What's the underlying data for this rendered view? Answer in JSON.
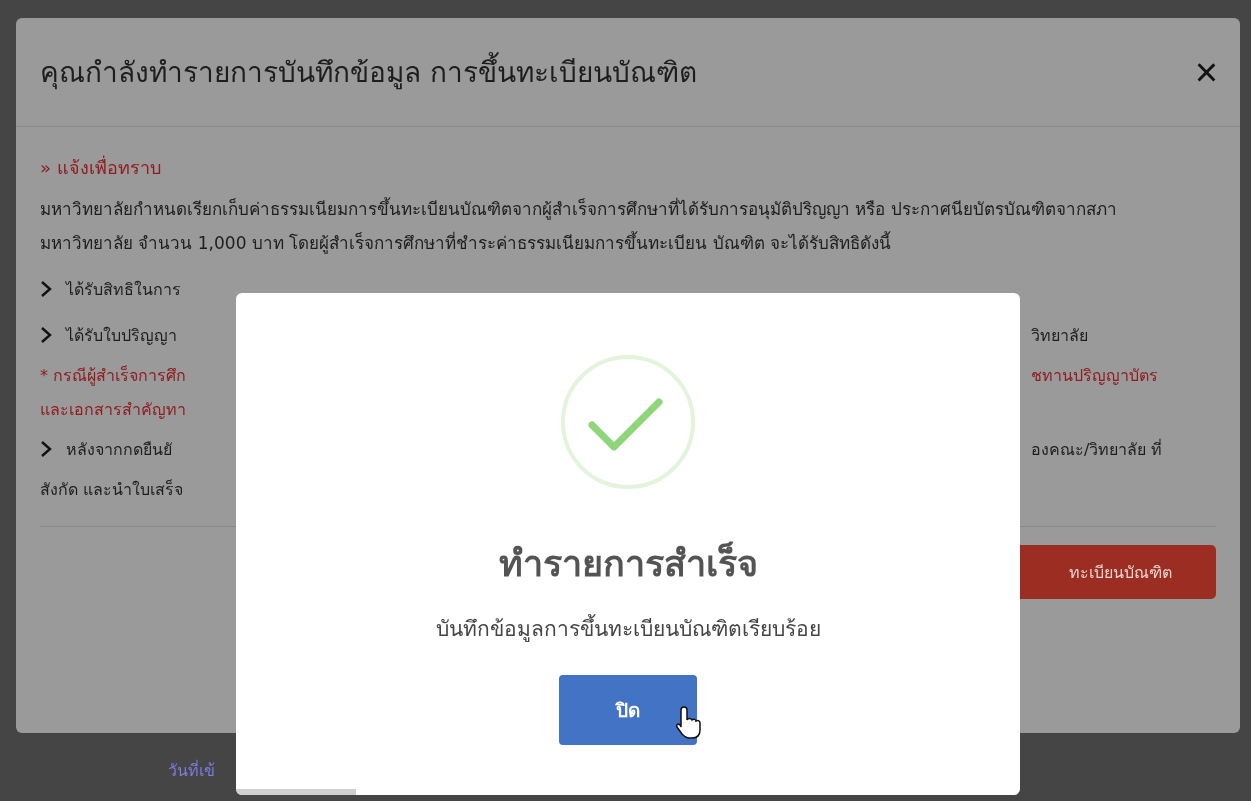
{
  "page": {
    "fragment": "วันที่เข้"
  },
  "modal": {
    "title": "คุณกำลังทำรายการบันทึกข้อมูล การขึ้นทะเบียนบัณฑิต",
    "close": "×",
    "notice": {
      "marker": "»",
      "heading": "แจ้งเพื่อทราบ"
    },
    "paragraph": "มหาวิทยาลัยกำหนดเรียกเก็บค่าธรรมเนียมการขึ้นทะเบียนบัณฑิตจากผู้สำเร็จการศึกษาที่ได้รับการอนุมัติปริญญา หรือ ประกาศนียบัตรบัณฑิตจากสภามหาวิทยาลัย จำนวน 1,000 บาท โดยผู้สำเร็จการศึกษาที่ชำระค่าธรรมเนียมการขึ้นทะเบียน บัณฑิต จะได้รับสิทธิดังนี้",
    "lines": [
      {
        "kind": "bullet",
        "left": "ได้รับสิทธิในการ"
      },
      {
        "kind": "bullet",
        "left": "ได้รับใบปริญญา",
        "right": "วิทยาลัย"
      },
      {
        "kind": "warning",
        "left": "* กรณีผู้สำเร็จการศึก",
        "right": "ชทานปริญญาบัตร"
      },
      {
        "kind": "warning",
        "left": "และเอกสารสำคัญทา"
      },
      {
        "kind": "bullet",
        "left": "หลังจากกดยืนยั",
        "right": "องคณะ/วิทยาลัย ที่"
      },
      {
        "kind": "plain",
        "left": "สังกัด และนำใบเสร็จ"
      }
    ],
    "submit": "ทะเบียนบัณฑิต"
  },
  "alert": {
    "title": "ทำรายการสำเร็จ",
    "message": "บันทึกข้อมูลการขึ้นทะเบียนบัณฑิตเรียบร้อย",
    "button": "ปิด"
  }
}
